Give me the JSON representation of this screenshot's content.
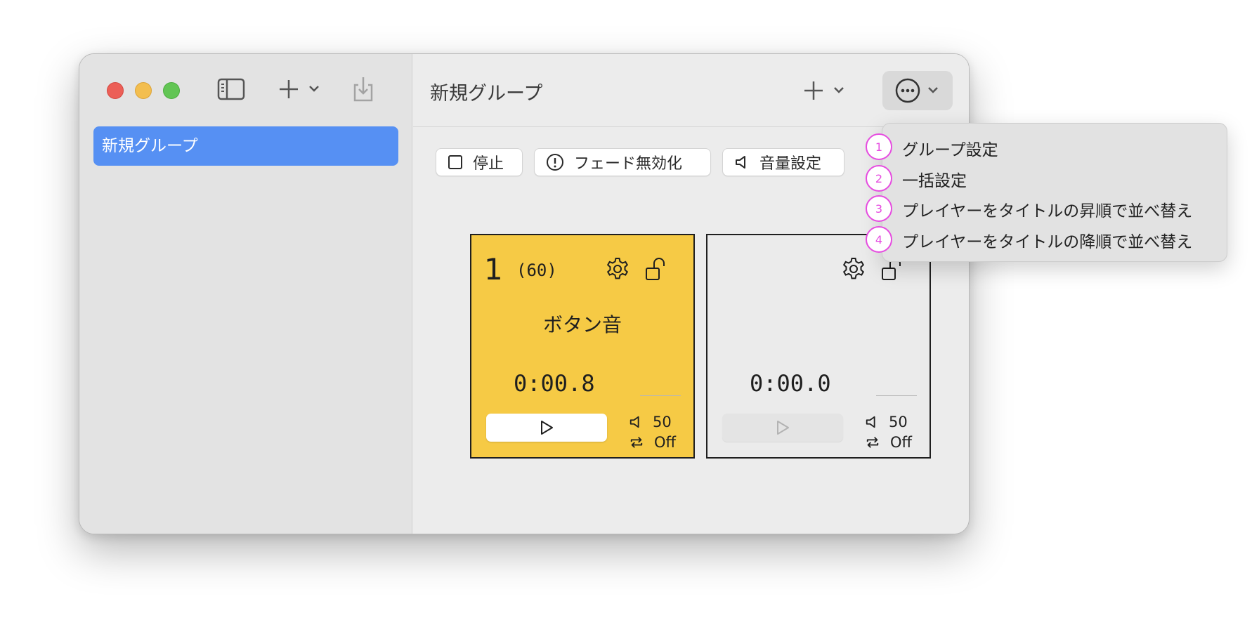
{
  "window": {
    "sidebar": {
      "items": [
        {
          "label": "新規グループ",
          "selected": true
        }
      ]
    },
    "toolbar": {
      "title": "新規グループ"
    },
    "actions": [
      {
        "label": "停止",
        "icon": "square-icon"
      },
      {
        "label": "フェード無効化",
        "icon": "exclamation-circle-icon"
      },
      {
        "label": "音量設定",
        "icon": "speaker-icon"
      }
    ],
    "players": [
      {
        "number": "1",
        "count": "(60)",
        "title": "ボタン音",
        "time": "0:00.8",
        "volume": "50",
        "loop": "Off",
        "active": true
      },
      {
        "number": "",
        "count": "",
        "title": "",
        "time": "0:00.0",
        "volume": "50",
        "loop": "Off",
        "active": false
      }
    ]
  },
  "menu": {
    "items": [
      {
        "badge": "1",
        "label": "グループ設定"
      },
      {
        "badge": "2",
        "label": "一括設定"
      },
      {
        "badge": "3",
        "label": "プレイヤーをタイトルの昇順で並べ替え"
      },
      {
        "badge": "4",
        "label": "プレイヤーをタイトルの降順で並べ替え"
      }
    ]
  },
  "colors": {
    "selection": "#5690f3",
    "card_active": "#f6ca45",
    "annotation": "#e64ce0"
  }
}
